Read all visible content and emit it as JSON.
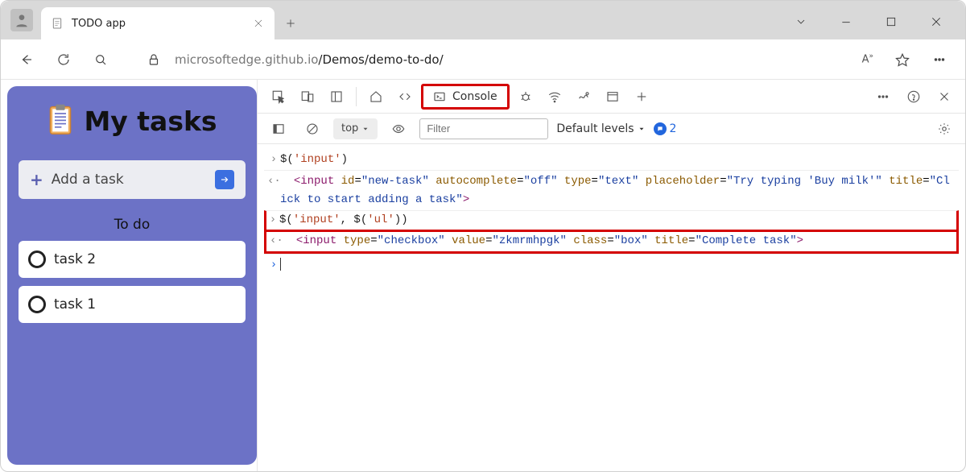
{
  "browser": {
    "tab_title": "TODO app",
    "url_prefix": "microsoftedge.github.io",
    "url_path": "/Demos/demo-to-do/",
    "read_aloud_label": "A"
  },
  "app": {
    "title": "My tasks",
    "add_placeholder": "Add a task",
    "section_label": "To do",
    "tasks": [
      {
        "label": "task 2"
      },
      {
        "label": "task 1"
      }
    ]
  },
  "devtools": {
    "tabs": {
      "console": "Console"
    },
    "toolbar": {
      "context": "top",
      "filter_placeholder": "Filter",
      "levels_label": "Default levels",
      "issue_count": "2"
    },
    "console": {
      "line1_cmd": "$('input')",
      "line1_result": "<input id=\"new-task\" autocomplete=\"off\" type=\"text\" placeholder=\"Try typing 'Buy milk'\" title=\"Click to start adding a task\">",
      "line2_cmd": "$('input', $('ul'))",
      "line2_result": "<input type=\"checkbox\" value=\"zkmrmhpgk\" class=\"box\" title=\"Complete task\">"
    }
  }
}
